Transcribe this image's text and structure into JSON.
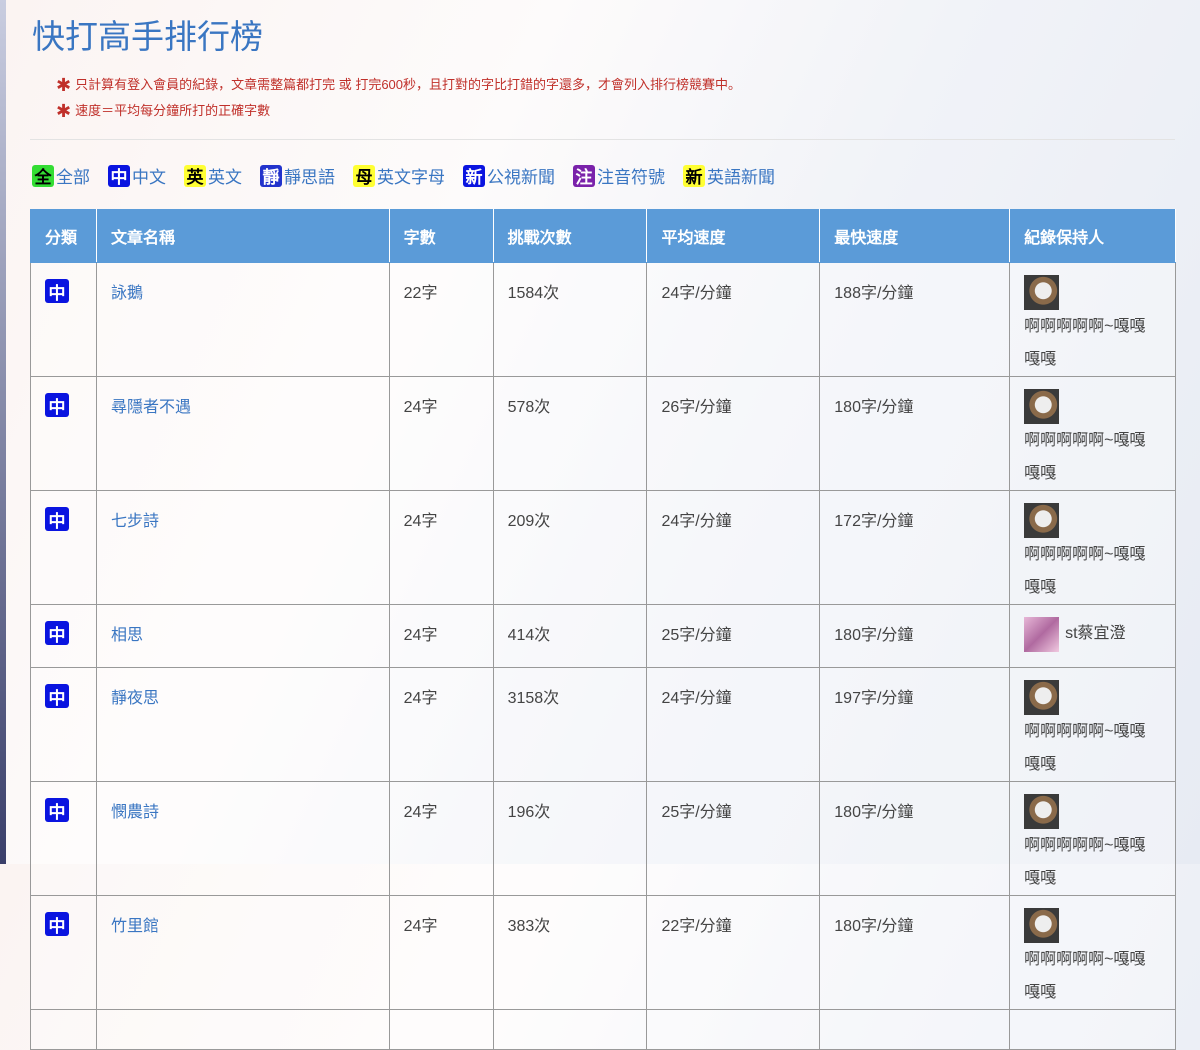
{
  "title": "快打高手排行榜",
  "notes": [
    "只計算有登入會員的紀錄，文章需整篇都打完 或 打完600秒，且打對的字比打錯的字還多，才會列入排行榜競賽中。",
    "速度＝平均每分鐘所打的正確字數"
  ],
  "filters": [
    {
      "badge": "全",
      "label": "全部",
      "bg": "#33dd33",
      "fg": "#000"
    },
    {
      "badge": "中",
      "label": "中文",
      "bg": "#0a14e0",
      "fg": "#fff"
    },
    {
      "badge": "英",
      "label": "英文",
      "bg": "#ffff33",
      "fg": "#000"
    },
    {
      "badge": "靜",
      "label": "靜思語",
      "bg": "#2233cc",
      "fg": "#fff"
    },
    {
      "badge": "母",
      "label": "英文字母",
      "bg": "#ffff33",
      "fg": "#000"
    },
    {
      "badge": "新",
      "label": "公視新聞",
      "bg": "#0a14e0",
      "fg": "#fff"
    },
    {
      "badge": "注",
      "label": "注音符號",
      "bg": "#7a22aa",
      "fg": "#fff"
    },
    {
      "badge": "新",
      "label": "英語新聞",
      "bg": "#ffff33",
      "fg": "#000"
    }
  ],
  "columns": [
    "分類",
    "文章名稱",
    "字數",
    "挑戰次數",
    "平均速度",
    "最快速度",
    "紀錄保持人"
  ],
  "rows": [
    {
      "cat": "中",
      "name": "詠鵝",
      "chars": "22字",
      "tries": "1584次",
      "avg": "24字/分鐘",
      "best": "188字/分鐘",
      "holder": "啊啊啊啊啊~嘎嘎嘎嘎"
    },
    {
      "cat": "中",
      "name": "尋隱者不遇",
      "chars": "24字",
      "tries": "578次",
      "avg": "26字/分鐘",
      "best": "180字/分鐘",
      "holder": "啊啊啊啊啊~嘎嘎嘎嘎"
    },
    {
      "cat": "中",
      "name": "七步詩",
      "chars": "24字",
      "tries": "209次",
      "avg": "24字/分鐘",
      "best": "172字/分鐘",
      "holder": "啊啊啊啊啊~嘎嘎嘎嘎"
    },
    {
      "cat": "中",
      "name": "相思",
      "chars": "24字",
      "tries": "414次",
      "avg": "25字/分鐘",
      "best": "180字/分鐘",
      "holder": "st蔡宜澄"
    },
    {
      "cat": "中",
      "name": "靜夜思",
      "chars": "24字",
      "tries": "3158次",
      "avg": "24字/分鐘",
      "best": "197字/分鐘",
      "holder": "啊啊啊啊啊~嘎嘎嘎嘎"
    },
    {
      "cat": "中",
      "name": "憫農詩",
      "chars": "24字",
      "tries": "196次",
      "avg": "25字/分鐘",
      "best": "180字/分鐘",
      "holder": "啊啊啊啊啊~嘎嘎嘎嘎"
    },
    {
      "cat": "中",
      "name": "竹里館",
      "chars": "24字",
      "tries": "383次",
      "avg": "22字/分鐘",
      "best": "180字/分鐘",
      "holder": "啊啊啊啊啊~嘎嘎嘎嘎"
    }
  ]
}
